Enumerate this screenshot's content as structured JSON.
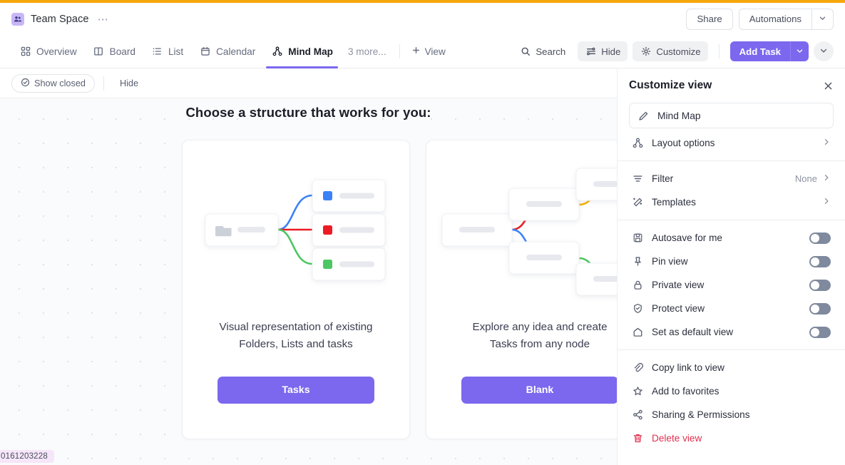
{
  "header": {
    "space_title": "Team Space",
    "more_dots": "⋯",
    "share_label": "Share",
    "automations_label": "Automations"
  },
  "tabs": [
    {
      "label": "Overview",
      "icon": "grid-icon",
      "active": false
    },
    {
      "label": "Board",
      "icon": "board-icon",
      "active": false
    },
    {
      "label": "List",
      "icon": "list-icon",
      "active": false
    },
    {
      "label": "Calendar",
      "icon": "calendar-icon",
      "active": false
    },
    {
      "label": "Mind Map",
      "icon": "mindmap-icon",
      "active": true
    }
  ],
  "tabbar": {
    "more_label": "3 more...",
    "add_view_label": "View",
    "search_label": "Search",
    "hide_label": "Hide",
    "customize_label": "Customize",
    "add_task_label": "Add Task"
  },
  "subbar": {
    "show_closed_label": "Show closed",
    "hide_label": "Hide"
  },
  "canvas": {
    "title": "Choose a structure that works for you:",
    "cards": [
      {
        "description": "Visual representation of existing\nFolders, Lists and tasks",
        "button_label": "Tasks"
      },
      {
        "description": "Explore any idea and create\nTasks from any node",
        "button_label": "Blank"
      }
    ],
    "id_badge": "0161203228"
  },
  "panel": {
    "title": "Customize view",
    "view_name": "Mind Map",
    "nav_rows": [
      {
        "label": "Layout options",
        "icon": "mindmap-icon",
        "value": "",
        "chevron": true
      }
    ],
    "config_rows": [
      {
        "label": "Filter",
        "icon": "filter-icon",
        "value": "None",
        "chevron": true
      },
      {
        "label": "Templates",
        "icon": "templates-icon",
        "value": "",
        "chevron": true
      }
    ],
    "toggle_rows": [
      {
        "label": "Autosave for me",
        "icon": "save-icon",
        "on": false
      },
      {
        "label": "Pin view",
        "icon": "pin-icon",
        "on": false
      },
      {
        "label": "Private view",
        "icon": "lock-icon",
        "on": false
      },
      {
        "label": "Protect view",
        "icon": "shield-check-icon",
        "on": false
      },
      {
        "label": "Set as default view",
        "icon": "home-icon",
        "on": false
      }
    ],
    "action_rows": [
      {
        "label": "Copy link to view",
        "icon": "link-icon",
        "danger": false
      },
      {
        "label": "Add to favorites",
        "icon": "star-icon",
        "danger": false
      },
      {
        "label": "Sharing & Permissions",
        "icon": "share-nodes-icon",
        "danger": false
      },
      {
        "label": "Delete view",
        "icon": "trash-icon",
        "danger": true
      }
    ]
  },
  "colors": {
    "accent_top": "#F5A70A",
    "primary": "#7B68EE",
    "danger": "#E0304E",
    "canvas_bg": "#FAFBFC"
  }
}
